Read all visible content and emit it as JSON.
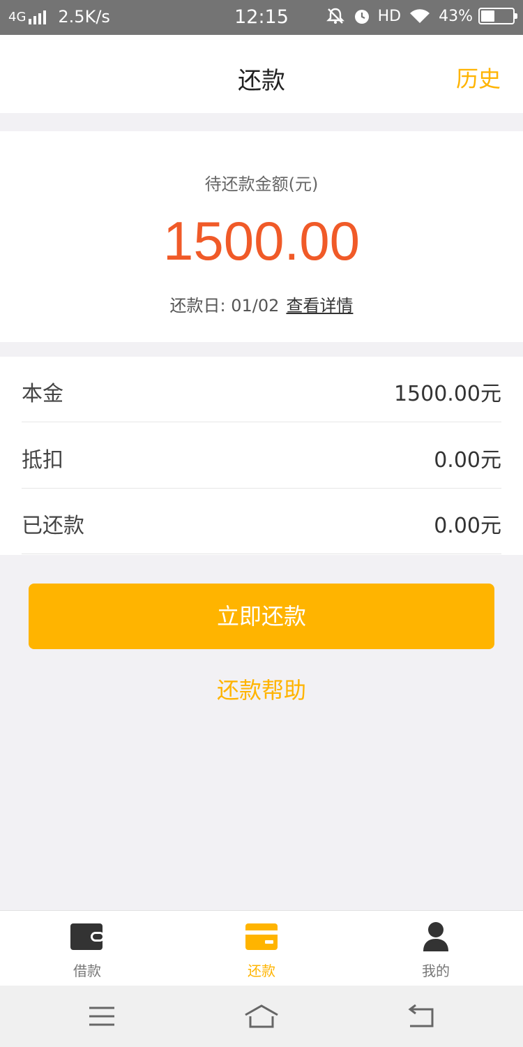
{
  "status_bar": {
    "network": "4G",
    "speed": "2.5K/s",
    "time": "12:15",
    "hd": "HD",
    "battery": "43%"
  },
  "header": {
    "title": "还款",
    "history_label": "历史"
  },
  "summary": {
    "label": "待还款金额(元)",
    "amount": "1500.00",
    "due_date_text": "还款日: 01/02",
    "details_link": "查看详情"
  },
  "details": [
    {
      "label": "本金",
      "value": "1500.00元"
    },
    {
      "label": "抵扣",
      "value": "0.00元"
    },
    {
      "label": "已还款",
      "value": "0.00元"
    }
  ],
  "actions": {
    "repay_now": "立即还款",
    "repay_help": "还款帮助"
  },
  "tabbar": {
    "items": [
      {
        "label": "借款",
        "icon": "wallet-icon",
        "active": false
      },
      {
        "label": "还款",
        "icon": "card-icon",
        "active": true
      },
      {
        "label": "我的",
        "icon": "user-icon",
        "active": false
      }
    ]
  },
  "colors": {
    "accent": "#ffb400",
    "amount": "#f05a28"
  }
}
